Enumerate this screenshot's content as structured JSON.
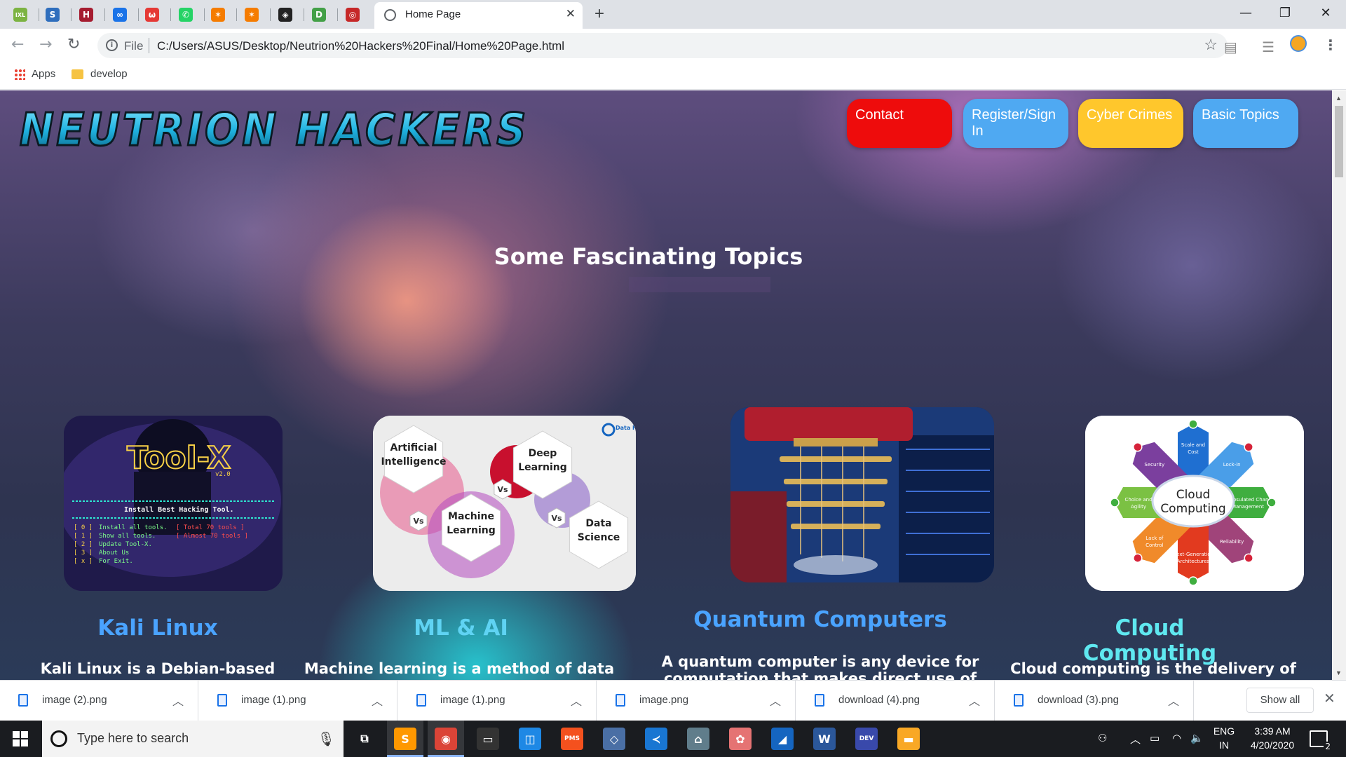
{
  "browser": {
    "pinned_tabs": [
      {
        "icon": "ixl-icon",
        "glyph": "IXL",
        "color": "#7cb342"
      },
      {
        "icon": "s-icon",
        "glyph": "S",
        "color": "#2f6ebd"
      },
      {
        "icon": "harvard-shield-icon",
        "glyph": "H",
        "color": "#a51c30"
      },
      {
        "icon": "infinity-icon",
        "glyph": "∞",
        "color": "#1a73e8"
      },
      {
        "icon": "flame-icon",
        "glyph": "ω",
        "color": "#e53935"
      },
      {
        "icon": "whatsapp-icon",
        "glyph": "✆",
        "color": "#25d366"
      },
      {
        "icon": "star-app-icon",
        "glyph": "✶",
        "color": "#f57c00"
      },
      {
        "icon": "star-app-icon-2",
        "glyph": "✶",
        "color": "#f57c00"
      },
      {
        "icon": "codepen-icon",
        "glyph": "◈",
        "color": "#222222"
      },
      {
        "icon": "d-app-icon",
        "glyph": "D",
        "color": "#43a047"
      },
      {
        "icon": "target-icon",
        "glyph": "◎",
        "color": "#c62828"
      }
    ],
    "active_tab": {
      "title": "Home Page"
    },
    "new_tab_label": "+",
    "window_controls": {
      "minimize": "—",
      "maximize": "❐",
      "close": "✕"
    },
    "address": {
      "scheme_label": "File",
      "url": "C:/Users/ASUS/Desktop/Neutrion%20Hackers%20Final/Home%20Page.html"
    },
    "bookmarks": [
      {
        "label": "Apps",
        "icon": "apps-grid-icon"
      },
      {
        "label": "develop",
        "icon": "folder-icon"
      }
    ]
  },
  "page": {
    "logo_text": "NEUTRION  HACKERS",
    "nav": [
      {
        "label": "Contact",
        "color": "#ee0c0c"
      },
      {
        "label": "Register/Sign In",
        "color": "#4fa9f2"
      },
      {
        "label": "Cyber Crimes",
        "color": "#ffc72c"
      },
      {
        "label": "Basic Topics",
        "color": "#4fa9f2"
      }
    ],
    "section_title": "Some Fascinating Topics",
    "topics": [
      {
        "title": "Kali Linux",
        "title_color": "#4aa3ff",
        "excerpt": "Kali Linux is a Debian-based",
        "image": {
          "banner": "Tool-X",
          "version": "v2.0",
          "subtitle": "Install Best Hacking Tool.",
          "menu": [
            {
              "key": "[ 0 ]",
              "text": "Install all tools.",
              "note": "[ Total 70 tools ]"
            },
            {
              "key": "[ 1 ]",
              "text": "Show all tools.",
              "note": "[ Almost 70 tools ]"
            },
            {
              "key": "[ 2 ]",
              "text": "Update Tool-X.",
              "note": ""
            },
            {
              "key": "[ 3 ]",
              "text": "About Us",
              "note": ""
            },
            {
              "key": "[ x ]",
              "text": "For Exit.",
              "note": ""
            }
          ]
        }
      },
      {
        "title": "ML & AI",
        "title_color": "#5fd3f3",
        "excerpt": "Machine learning is a method of data",
        "image": {
          "hexes": [
            "Artificial Intelligence",
            "Deep Learning",
            "Machine Learning",
            "Data Science"
          ],
          "vs_label": "Vs",
          "brand": "Data Flair"
        }
      },
      {
        "title": "Quantum Computers",
        "title_color": "#4aa3ff",
        "excerpt": "A quantum computer is any device for computation that makes direct use of",
        "image": {
          "description": "quantum-computer-photo"
        }
      },
      {
        "title": "Cloud Computing",
        "title_color": "#5fe8f0",
        "excerpt": "Cloud computing is the delivery of",
        "image": {
          "center": "Cloud Computing",
          "petals": [
            {
              "label": "Scale and Cost",
              "color": "#1f6fd1"
            },
            {
              "label": "Lock-in",
              "color": "#4a9ee8"
            },
            {
              "label": "Encapsulated Change Management",
              "color": "#3fae3f"
            },
            {
              "label": "Reliability",
              "color": "#a0447a"
            },
            {
              "label": "Next-Generation Architectures",
              "color": "#e23a1f"
            },
            {
              "label": "Lack of Control",
              "color": "#f08a2a"
            },
            {
              "label": "Choice and Agility",
              "color": "#7bc143"
            },
            {
              "label": "Security",
              "color": "#7b3f9e"
            }
          ]
        }
      }
    ]
  },
  "downloads": {
    "items": [
      {
        "name": "image (2).png"
      },
      {
        "name": "image (1).png"
      },
      {
        "name": "image (1).png"
      },
      {
        "name": "image.png"
      },
      {
        "name": "download (4).png"
      },
      {
        "name": "download (3).png"
      }
    ],
    "show_all_label": "Show all"
  },
  "taskbar": {
    "search_placeholder": "Type here to search",
    "apps": [
      {
        "icon": "task-view-icon",
        "glyph": "⧉",
        "color": "transparent"
      },
      {
        "icon": "sublime-text-icon",
        "glyph": "S",
        "color": "#ff9800"
      },
      {
        "icon": "chrome-icon",
        "glyph": "◉",
        "color": "#db4437"
      },
      {
        "icon": "terminal-icon",
        "glyph": "▭",
        "color": "#333333"
      },
      {
        "icon": "virtual-desktop-icon",
        "glyph": "◫",
        "color": "#1e88e5"
      },
      {
        "icon": "pms-icon",
        "glyph": "PMS",
        "color": "#f4511e"
      },
      {
        "icon": "virtualbox-icon",
        "glyph": "◇",
        "color": "#4a6fa5"
      },
      {
        "icon": "vscode-icon",
        "glyph": "≺",
        "color": "#1976d2"
      },
      {
        "icon": "network-icon",
        "glyph": "⌂",
        "color": "#607d8b"
      },
      {
        "icon": "paint-icon",
        "glyph": "✿",
        "color": "#e57373"
      },
      {
        "icon": "shark-icon",
        "glyph": "◢",
        "color": "#1565c0"
      },
      {
        "icon": "word-icon",
        "glyph": "W",
        "color": "#2b579a"
      },
      {
        "icon": "devc-icon",
        "glyph": "DEV",
        "color": "#3949ab"
      },
      {
        "icon": "file-explorer-icon",
        "glyph": "▬",
        "color": "#f9a825"
      }
    ],
    "tray": {
      "language_line1": "ENG",
      "language_line2": "IN",
      "time": "3:39 AM",
      "date": "4/20/2020",
      "notifications": "2"
    }
  }
}
